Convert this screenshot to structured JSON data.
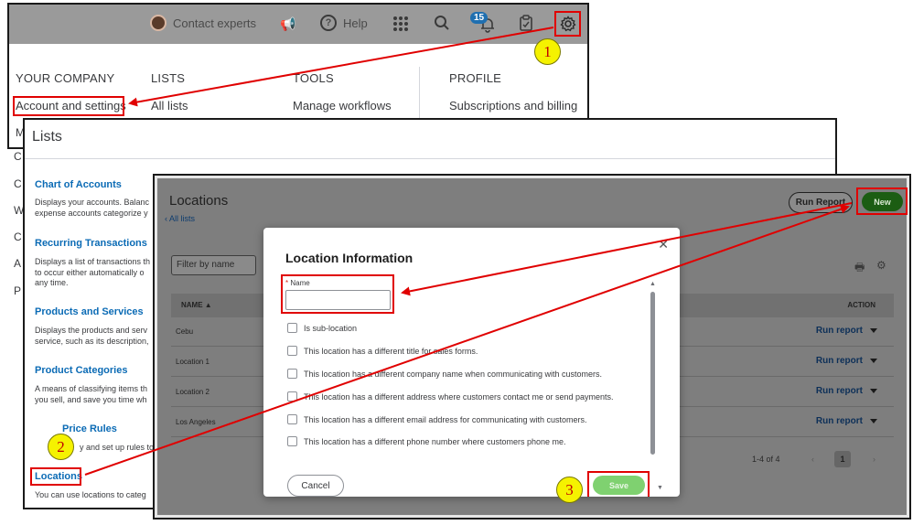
{
  "topbar": {
    "contact_experts": "Contact experts",
    "help": "Help",
    "notification_count": "15"
  },
  "settings_menu": {
    "columns": [
      {
        "heading": "YOUR COMPANY",
        "link": "Account and settings"
      },
      {
        "heading": "LISTS",
        "link": "All lists"
      },
      {
        "heading": "TOOLS",
        "link": "Manage workflows"
      },
      {
        "heading": "PROFILE",
        "link": "Subscriptions and billing"
      }
    ],
    "partial_letters": [
      "M",
      "C",
      "C",
      "W",
      "C",
      "A",
      "P"
    ]
  },
  "lists_page": {
    "title": "Lists",
    "items": [
      {
        "name": "Chart of Accounts",
        "desc1": "Displays your accounts. Balanc",
        "desc2": "expense accounts categorize y"
      },
      {
        "name": "Recurring Transactions",
        "desc1": "Displays a list of transactions th",
        "desc2": "to occur either automatically o",
        "desc3": "any time."
      },
      {
        "name": "Products and Services",
        "desc1": "Displays the products and serv",
        "desc2": "service, such as its description,"
      },
      {
        "name": "Product Categories",
        "desc1": "A means of classifying items th",
        "desc2": "you sell, and save you time wh"
      },
      {
        "name": "Price Rules",
        "desc1": "y and set up rules to"
      },
      {
        "name": "Locations",
        "desc1": "You can use locations to categ"
      }
    ]
  },
  "locations_page": {
    "title": "Locations",
    "back_link": "All lists",
    "run_report_button": "Run Report",
    "new_button": "New",
    "filter_placeholder": "Filter by name",
    "columns": {
      "name": "NAME",
      "action": "ACTION"
    },
    "rows": [
      {
        "name": "Cebu",
        "action": "Run report"
      },
      {
        "name": "Location 1",
        "action": "Run report"
      },
      {
        "name": "Location 2",
        "action": "Run report"
      },
      {
        "name": "Los Angeles",
        "action": "Run report"
      }
    ],
    "pager_count": "1-4 of 4",
    "current_page": "1"
  },
  "dialog": {
    "title": "Location Information",
    "name_label": "Name",
    "name_value": "",
    "checkboxes": [
      "Is sub-location",
      "This location has a different title for sales forms.",
      "This location has a different company name when communicating with customers.",
      "This location has a different address where customers contact me or send payments.",
      "This location has a different email address for communicating with customers.",
      "This location has a different phone number where customers phone me."
    ],
    "cancel_button": "Cancel",
    "save_button": "Save"
  },
  "annotations": {
    "steps": [
      "1",
      "2",
      "3"
    ]
  },
  "colors": {
    "annotation_red": "#e00000",
    "step_yellow": "#f5f200",
    "link_blue": "#0b6bb5",
    "new_green": "#2ca01c"
  }
}
